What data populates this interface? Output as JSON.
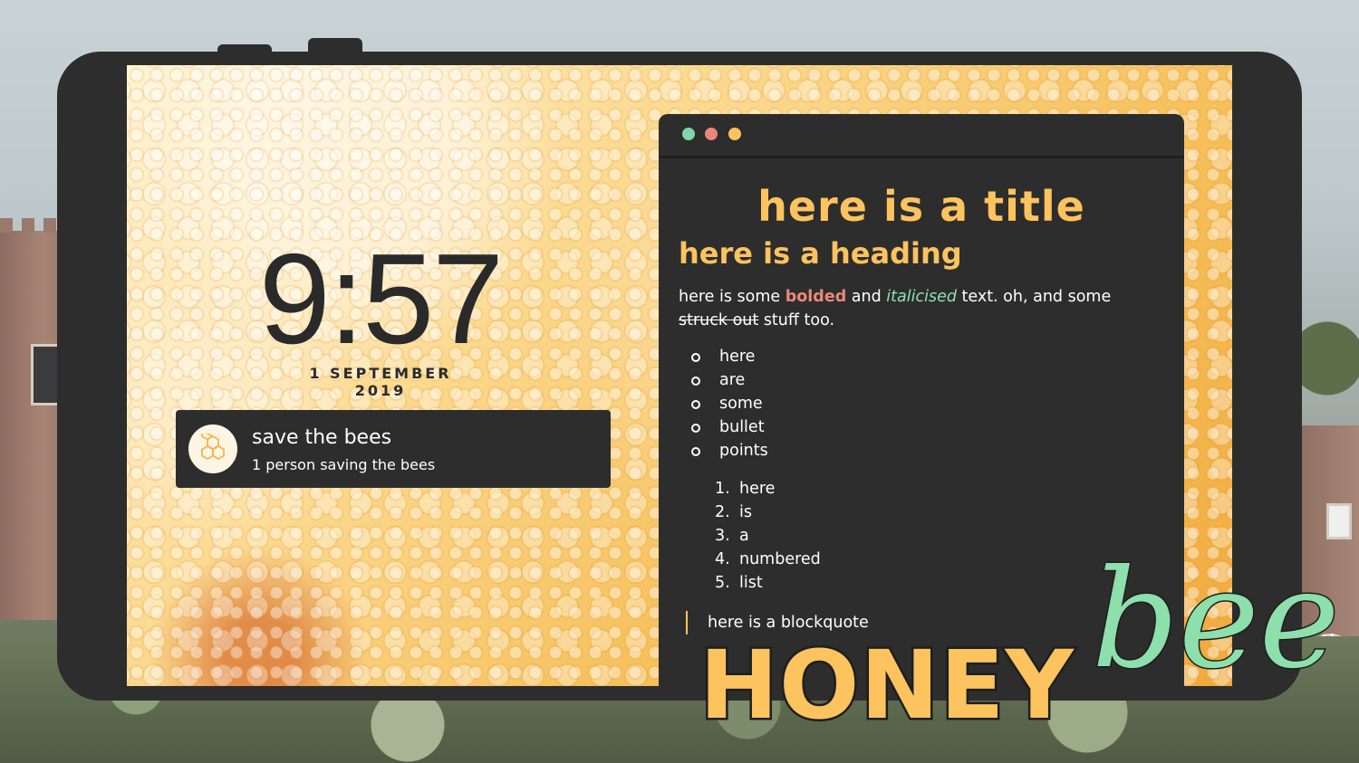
{
  "lockscreen": {
    "time": "9:57",
    "date": "1 SEPTEMBER 2019",
    "notification": {
      "title": "save the bees",
      "subtitle": "1 person saving the bees",
      "icon": "honeycomb-icon"
    }
  },
  "window": {
    "controls": [
      {
        "name": "green",
        "color": "#7fd8a5"
      },
      {
        "name": "red",
        "color": "#e8877a"
      },
      {
        "name": "yellow",
        "color": "#fcc35e"
      }
    ],
    "title": "here is a title",
    "heading": "here is a heading",
    "paragraph": {
      "p1": "here is some ",
      "bold": "bolded",
      "p2": " and ",
      "italic": "italicised",
      "p3": " text. oh, and some ",
      "struck": "struck out",
      "p4": " stuff too."
    },
    "bullets": [
      "here",
      "are",
      "some",
      "bullet",
      "points"
    ],
    "numbered": [
      {
        "n": "1.",
        "text": "here"
      },
      {
        "n": "2.",
        "text": "is"
      },
      {
        "n": "3.",
        "text": "a"
      },
      {
        "n": "4.",
        "text": "numbered"
      },
      {
        "n": "5.",
        "text": "list"
      }
    ],
    "blockquote": "here is a blockquote"
  },
  "logo": {
    "word": "HONEY",
    "script": "bee"
  },
  "colors": {
    "accent": "#fcc35e",
    "bold": "#e8897a",
    "italic": "#8ee0b0",
    "panel": "#2d2d2d"
  }
}
